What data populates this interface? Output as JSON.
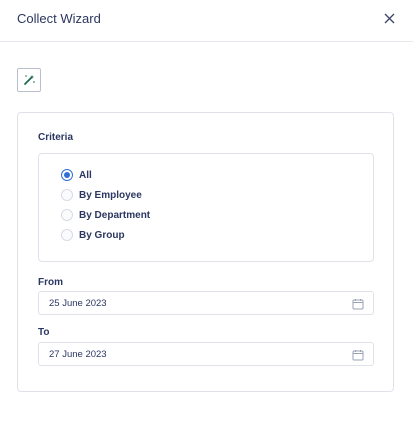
{
  "dialog": {
    "title": "Collect Wizard",
    "close_icon": "close-icon"
  },
  "toolbar": {
    "wand_icon": "magic-wand-icon"
  },
  "criteria": {
    "label": "Criteria",
    "options": [
      {
        "label": "All",
        "checked": true
      },
      {
        "label": "By Employee",
        "checked": false
      },
      {
        "label": "By Department",
        "checked": false
      },
      {
        "label": "By Group",
        "checked": false
      }
    ]
  },
  "from": {
    "label": "From",
    "value": "25 June 2023",
    "icon": "calendar-icon"
  },
  "to": {
    "label": "To",
    "value": "27 June 2023",
    "icon": "calendar-icon"
  },
  "colors": {
    "accent": "#2f6fd6",
    "text": "#2b3760",
    "border": "#dfe2ea"
  }
}
